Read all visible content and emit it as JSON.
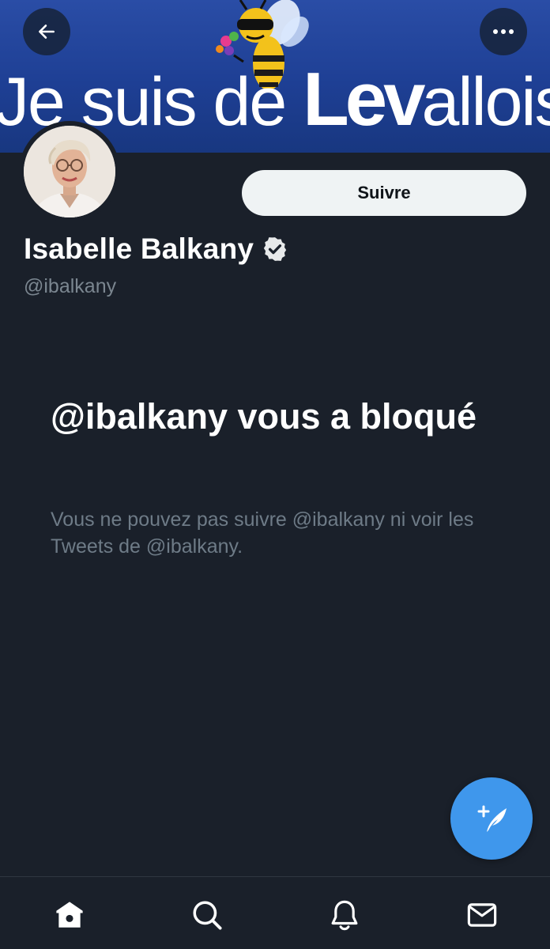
{
  "header": {
    "banner_text_light_1": "Je suis de ",
    "banner_text_bold": "Lev",
    "banner_text_light_2": "allois"
  },
  "profile": {
    "name": "Isabelle Balkany",
    "handle": "@ibalkany",
    "verified": true,
    "follow_label": "Suivre"
  },
  "blocked": {
    "title": "@ibalkany vous a bloqué",
    "description": "Vous ne pouvez pas suivre @ibalkany ni voir les Tweets de @ibalkany."
  },
  "icons": {
    "back": "back-arrow-icon",
    "more": "more-horizontal-icon",
    "compose": "compose-tweet-icon",
    "home": "home-icon",
    "search": "search-icon",
    "notifications": "bell-icon",
    "messages": "mail-icon"
  },
  "colors": {
    "background": "#1a202a",
    "accent": "#3f97ec",
    "text_primary": "#ffffff",
    "text_secondary": "#6e7b87"
  }
}
